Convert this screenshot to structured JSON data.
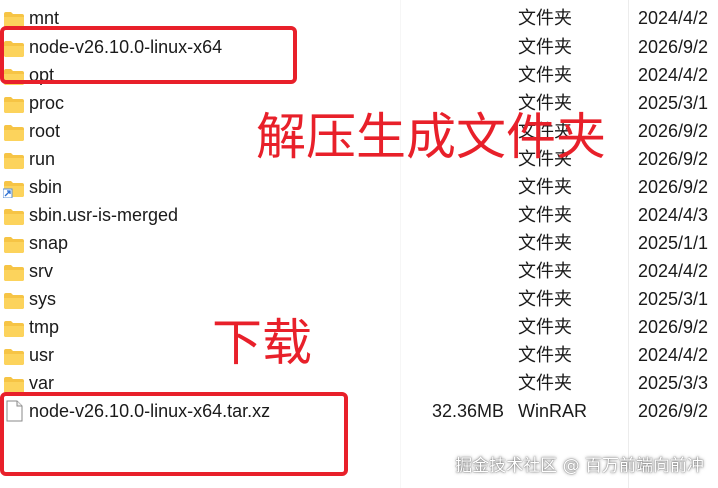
{
  "rows": [
    {
      "name": "mnt",
      "size": "",
      "type": "文件夹",
      "date": "2024/4/2",
      "icon": "folder-icon"
    },
    {
      "name": "node-v26.10.0-linux-x64",
      "size": "",
      "type": "文件夹",
      "date": "2026/9/2",
      "icon": "folder-icon"
    },
    {
      "name": "opt",
      "size": "",
      "type": "文件夹",
      "date": "2024/4/2",
      "icon": "folder-icon"
    },
    {
      "name": "proc",
      "size": "",
      "type": "文件夹",
      "date": "2025/3/1",
      "icon": "folder-icon"
    },
    {
      "name": "root",
      "size": "",
      "type": "文件夹",
      "date": "2026/9/2",
      "icon": "folder-icon"
    },
    {
      "name": "run",
      "size": "",
      "type": "文件夹",
      "date": "2026/9/2",
      "icon": "folder-icon"
    },
    {
      "name": "sbin",
      "size": "",
      "type": "文件夹",
      "date": "2026/9/2",
      "icon": "folder-shortcut-icon"
    },
    {
      "name": "sbin.usr-is-merged",
      "size": "",
      "type": "文件夹",
      "date": "2024/4/3",
      "icon": "folder-icon"
    },
    {
      "name": "snap",
      "size": "",
      "type": "文件夹",
      "date": "2025/1/1",
      "icon": "folder-icon"
    },
    {
      "name": "srv",
      "size": "",
      "type": "文件夹",
      "date": "2024/4/2",
      "icon": "folder-icon"
    },
    {
      "name": "sys",
      "size": "",
      "type": "文件夹",
      "date": "2025/3/1",
      "icon": "folder-icon"
    },
    {
      "name": "tmp",
      "size": "",
      "type": "文件夹",
      "date": "2026/9/2",
      "icon": "folder-icon"
    },
    {
      "name": "usr",
      "size": "",
      "type": "文件夹",
      "date": "2024/4/2",
      "icon": "folder-icon"
    },
    {
      "name": "var",
      "size": "",
      "type": "文件夹",
      "date": "2025/3/3",
      "icon": "folder-icon"
    },
    {
      "name": "node-v26.10.0-linux-x64.tar.xz",
      "size": "32.36MB",
      "type": "WinRAR",
      "date": "2026/9/2",
      "icon": "file-icon"
    }
  ],
  "annotations": {
    "extract_label": "解压生成文件夹",
    "download_label": "下载"
  },
  "watermark": "掘金技术社区 @ 百万前端向前冲",
  "colors": {
    "highlight": "#e8202a",
    "folder": "#f6c445"
  }
}
